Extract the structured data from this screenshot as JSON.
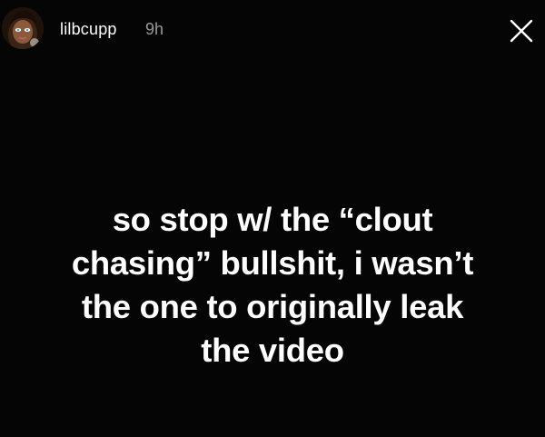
{
  "header": {
    "username": "lilbcupp",
    "timestamp": "9h"
  },
  "icons": {
    "avatar": "profile-avatar",
    "close": "close-icon"
  },
  "caption": {
    "lines": [
      "so stop w/ the “clout",
      "chasing” bullshit, i wasn’t",
      "the one to originally leak",
      "the video"
    ]
  },
  "colors": {
    "background": "#050505",
    "text": "#ffffff",
    "timestamp": "#9a9a9a"
  }
}
